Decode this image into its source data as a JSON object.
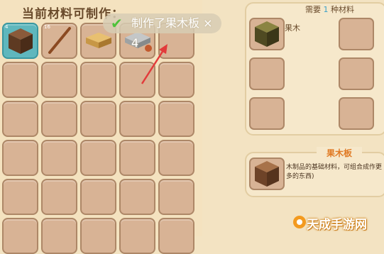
{
  "craft_panel": {
    "title": "当前材料可制作：",
    "slots": [
      {
        "count": "4",
        "item": "wood-block-icon",
        "selected": true
      },
      {
        "count": "16",
        "item": "stick-icon"
      },
      {
        "count": "",
        "item": "plank-slab-icon"
      },
      {
        "count": "",
        "item": "stone-slab-icon"
      }
    ]
  },
  "toast": {
    "text": "制作了果木板 × 4"
  },
  "requirement": {
    "label_before": "需要",
    "count": "1",
    "label_after": "种材料",
    "material_name": "果木"
  },
  "info": {
    "title": "果木板",
    "description": "木制品的基础材料，可组合成作更多的东西)"
  },
  "watermark": {
    "text": "天成手游网"
  },
  "colors": {
    "background": "#f4e2bf",
    "slot": "#d8b395",
    "slot_border": "#ad8767",
    "selected_slot": "#5fb7bd",
    "highlight_text": "#e07a24",
    "arrow": "#e23b3b"
  }
}
